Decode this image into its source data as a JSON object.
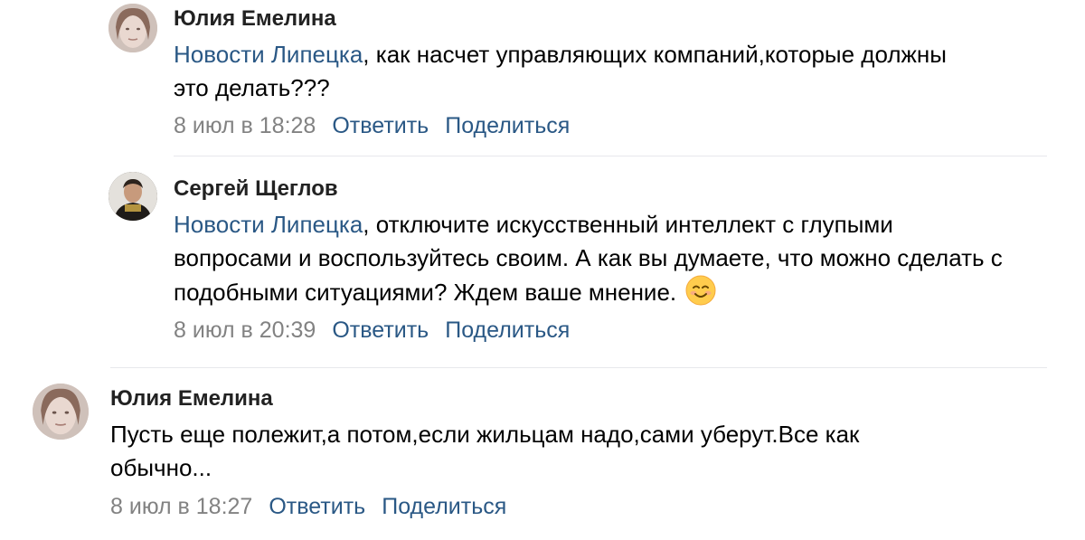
{
  "comments": [
    {
      "author": "Юлия Емелина",
      "mention": "Новости Липецка",
      "text": ", как насчет управляющих компаний,которые должны это делать???",
      "time": "8 июл в 18:28",
      "reply_label": "Ответить",
      "share_label": "Поделиться"
    },
    {
      "author": "Сергей Щеглов",
      "mention": "Новости Липецка",
      "text": ", отключите искусственный интеллект с глупыми вопросами и воспользуйтесь своим. А как вы думаете, что можно сделать с подобными ситуациями? Ждем ваше мнение.",
      "emoji": "smiling-face-emoji",
      "time": "8 июл в 20:39",
      "reply_label": "Ответить",
      "share_label": "Поделиться"
    },
    {
      "author": "Юлия Емелина",
      "text": "Пусть еще полежит,а потом,если жильцам надо,сами уберут.Все как обычно...",
      "time": "8 июл в 18:27",
      "reply_label": "Ответить",
      "share_label": "Поделиться"
    }
  ],
  "colors": {
    "link": "#2a5885",
    "meta": "#828282",
    "divider": "#e7e8ec"
  }
}
